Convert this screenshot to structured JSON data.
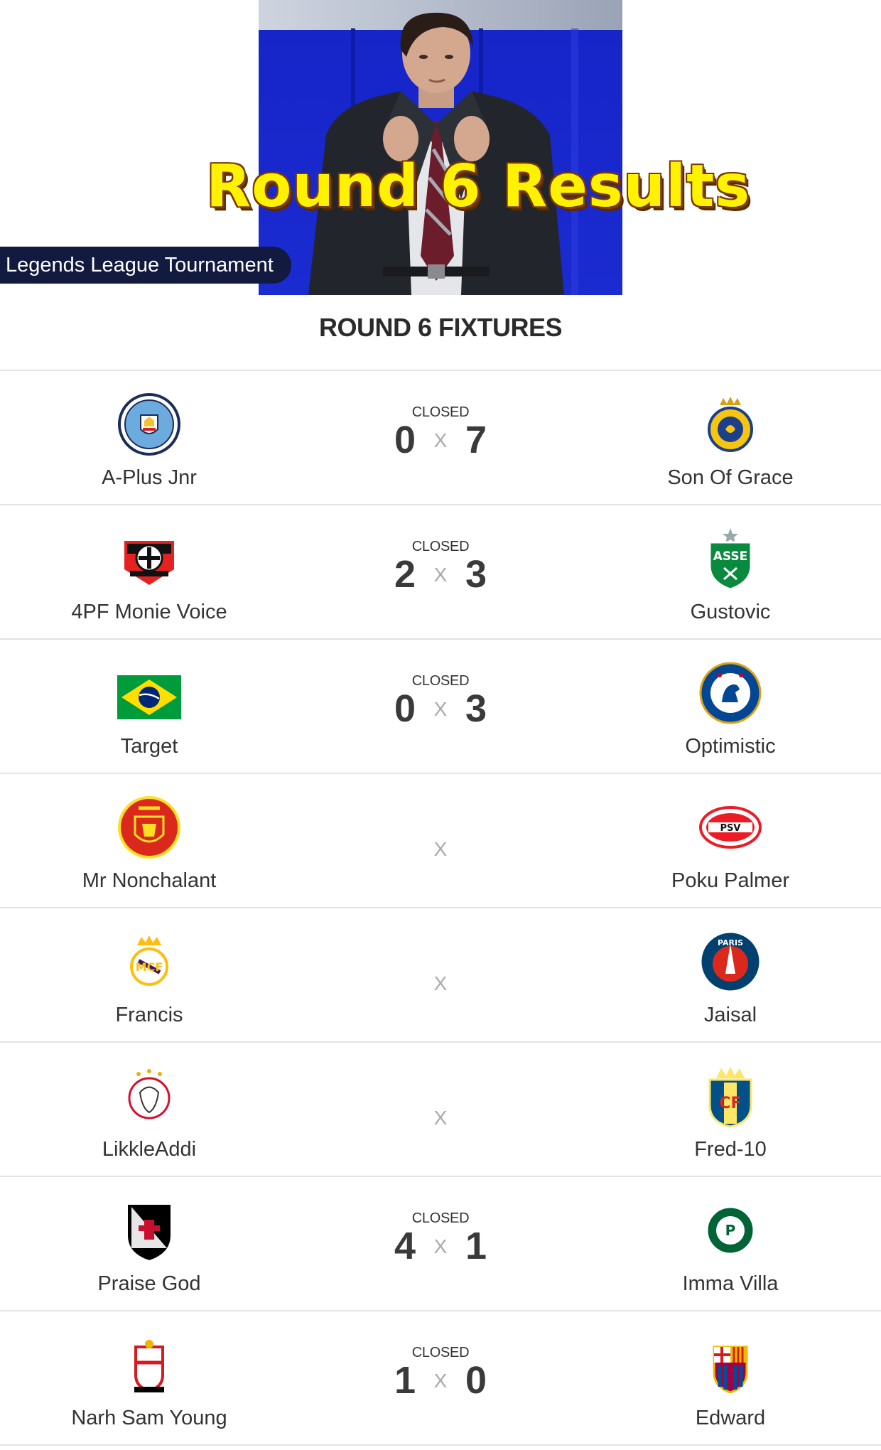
{
  "banner": {
    "title": "Round 6 Results",
    "league": "Legends League Tournament"
  },
  "section_title": "ROUND 6 FIXTURES",
  "separator": "X",
  "fixtures": [
    {
      "status": "CLOSED",
      "home": {
        "name": "A-Plus Jnr",
        "crest": "manchester-city-crest"
      },
      "away": {
        "name": "Son Of Grace",
        "crest": "al-nassr-crest"
      },
      "home_score": "0",
      "away_score": "7"
    },
    {
      "status": "CLOSED",
      "home": {
        "name": "4PF Monie Voice",
        "crest": "bayer-leverkusen-crest"
      },
      "away": {
        "name": "Gustovic",
        "crest": "saint-etienne-crest"
      },
      "home_score": "2",
      "away_score": "3"
    },
    {
      "status": "CLOSED",
      "home": {
        "name": "Target",
        "crest": "brazil-flag"
      },
      "away": {
        "name": "Optimistic",
        "crest": "chelsea-crest"
      },
      "home_score": "0",
      "away_score": "3"
    },
    {
      "status": "",
      "home": {
        "name": "Mr Nonchalant",
        "crest": "manchester-united-crest"
      },
      "away": {
        "name": "Poku Palmer",
        "crest": "psv-crest"
      },
      "home_score": "",
      "away_score": ""
    },
    {
      "status": "",
      "home": {
        "name": "Francis",
        "crest": "real-madrid-crest"
      },
      "away": {
        "name": "Jaisal",
        "crest": "psg-crest"
      },
      "home_score": "",
      "away_score": ""
    },
    {
      "status": "",
      "home": {
        "name": "LikkleAddi",
        "crest": "ajax-crest"
      },
      "away": {
        "name": "Fred-10",
        "crest": "villarreal-crest"
      },
      "home_score": "",
      "away_score": ""
    },
    {
      "status": "CLOSED",
      "home": {
        "name": "Praise God",
        "crest": "vasco-da-gama-crest"
      },
      "away": {
        "name": "Imma Villa",
        "crest": "palmeiras-crest"
      },
      "home_score": "4",
      "away_score": "1"
    },
    {
      "status": "CLOSED",
      "home": {
        "name": "Narh Sam Young",
        "crest": "southampton-crest"
      },
      "away": {
        "name": "Edward",
        "crest": "barcelona-crest"
      },
      "home_score": "1",
      "away_score": "0"
    }
  ]
}
